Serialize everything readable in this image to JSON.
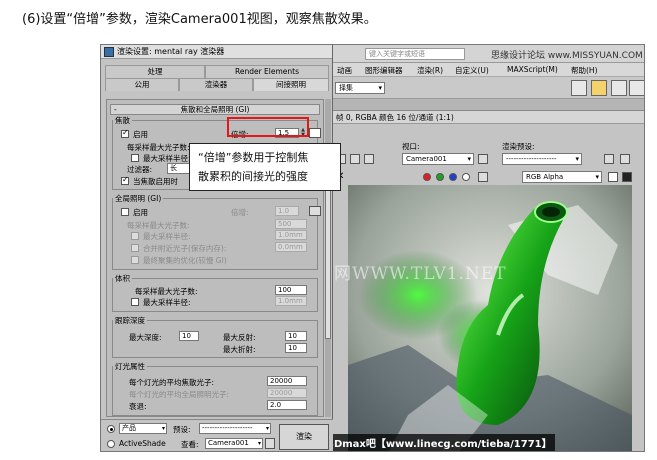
{
  "caption": "(6)设置“倍增”参数，渲染Camera001视图，观察焦散效果。",
  "callout": {
    "line1": "“倍增”参数用于控制焦",
    "line2": "散累积的间接光的强度"
  },
  "dialog": {
    "title": "渲染设置: mental ray 渲染器",
    "tabs_row1": [
      "处理",
      "Render Elements"
    ],
    "tabs_row2": [
      "公用",
      "渲染器",
      "间接照明"
    ],
    "rollout_title": "焦散和全局照明 (GI)",
    "caustics": {
      "group": "焦散",
      "enable": "启用",
      "multiplier_label": "倍增:",
      "multiplier_value": "1.5",
      "max_photons_label": "每采样最大光子数:",
      "max_radius_label": "最大采样半径:",
      "filter_label": "过滤器:",
      "filter_value": "长",
      "when_enabled": "当焦散启用时"
    },
    "gi": {
      "group": "全局照明 (GI)",
      "enable": "启用",
      "multiplier_label": "倍增:",
      "multiplier_value": "1.0",
      "max_photons_label": "每采样最大光子数:",
      "max_photons_value": "500",
      "max_radius_label": "最大采样半径:",
      "max_radius_value": "1.0mm",
      "merge_label": "合并附近光子(保存内存):",
      "merge_value": "0.0mm",
      "final_gather_label": "最终聚集的优化(较慢 GI)"
    },
    "volume": {
      "group": "体积",
      "max_photons_label": "每采样最大光子数:",
      "max_photons_value": "100",
      "max_radius_label": "最大采样半径:",
      "max_radius_value": "1.0mm"
    },
    "trace": {
      "group": "跟踪深度",
      "max_depth_label": "最大深度:",
      "max_depth_value": "10",
      "max_reflect_label": "最大反射:",
      "max_reflect_value": "10",
      "max_refract_label": "最大折射:",
      "max_refract_value": "10"
    },
    "light": {
      "group": "灯光属性",
      "avg_caustic_label": "每个灯光的平均焦散光子:",
      "avg_caustic_value": "20000",
      "avg_gi_label": "每个灯光的平均全局照明光子:",
      "avg_gi_value": "20000",
      "decay_label": "衰退:",
      "decay_value": "2.0"
    },
    "bottom": {
      "product": "产品",
      "activeshade": "ActiveShade",
      "preset_label": "预设:",
      "preset_value": "--------------------",
      "view_label": "查看:",
      "view_value": "Camera001",
      "render_button": "渲染"
    }
  },
  "backdrop": {
    "search_placeholder": "键入关键字或短语",
    "site_watermark": "思缘设计论坛 www.MISSYUAN.COM",
    "menu": [
      "动画",
      "图形编辑器",
      "渲染(R)",
      "自定义(U)",
      "MAXScript(M)",
      "帮助(H)"
    ],
    "left_menu_fragment": "择集",
    "framebuffer_title": "帧 0, RGBA 颜色 16 位/通道 (1:1)",
    "viewport_label": "视口:",
    "viewport_value": "Camera001",
    "render_preset_label": "渲染预设:",
    "render_preset_value": "--------------------",
    "channel_value": "RGB Alpha",
    "center_watermark": "中国教程网WWW.TLV1.NET",
    "bottom_watermark": "3Dmax吧【www.linecg.com/tieba/1771】"
  }
}
